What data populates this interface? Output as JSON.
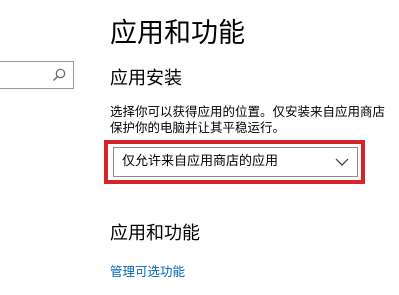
{
  "page": {
    "title": "应用和功能"
  },
  "search": {
    "icon": "search-icon"
  },
  "install_section": {
    "heading": "应用安装",
    "description_lines": [
      "选择你可以获得应用的位置。仅安装来自应用商店",
      "保护你的电脑并让其平稳运行。"
    ],
    "dropdown": {
      "selected": "仅允许来自应用商店的应用",
      "icon": "chevron-down-icon"
    }
  },
  "apps_section": {
    "heading": "应用和功能",
    "manage_optional_features_link": "管理可选功能"
  },
  "colors": {
    "accent_link": "#0067b8",
    "highlight_border": "#d8232a",
    "background": "#ffffff",
    "text": "#000000"
  }
}
